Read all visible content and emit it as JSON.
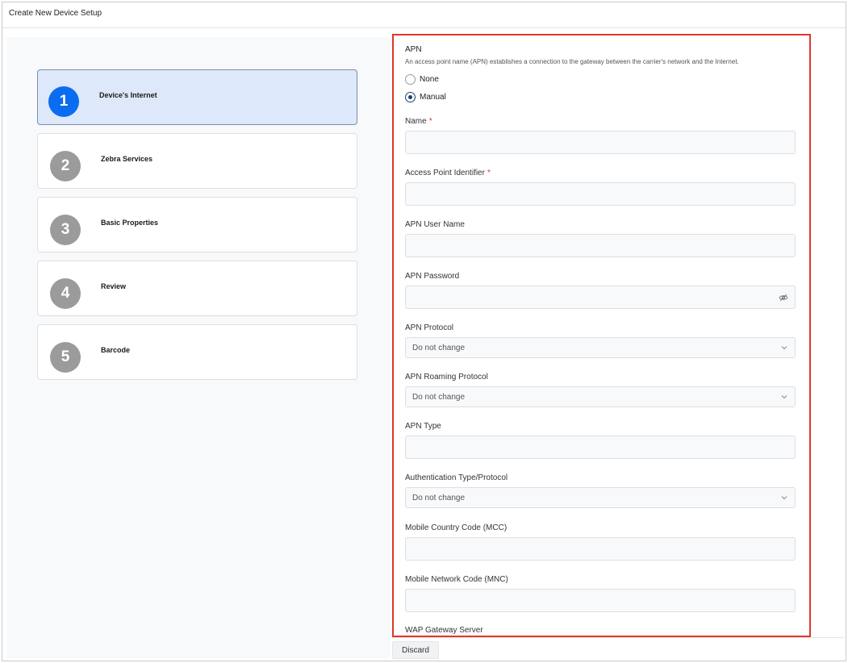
{
  "window": {
    "title": "Create New Device Setup"
  },
  "steps": [
    {
      "number": "1",
      "label": "Device's Internet",
      "active": true
    },
    {
      "number": "2",
      "label": "Zebra Services",
      "active": false
    },
    {
      "number": "3",
      "label": "Basic Properties",
      "active": false
    },
    {
      "number": "4",
      "label": "Review",
      "active": false
    },
    {
      "number": "5",
      "label": "Barcode",
      "active": false
    }
  ],
  "apn": {
    "title": "APN",
    "description": "An access point name (APN) establishes a connection to the gateway between the carrier's network and the Internet.",
    "options": [
      {
        "label": "None",
        "selected": false
      },
      {
        "label": "Manual",
        "selected": true
      }
    ]
  },
  "fields": {
    "name": {
      "label": "Name",
      "required_mark": "*",
      "value": ""
    },
    "access_point_identifier": {
      "label": "Access Point Identifier",
      "required_mark": "*",
      "value": ""
    },
    "apn_user_name": {
      "label": "APN User Name",
      "value": ""
    },
    "apn_password": {
      "label": "APN Password",
      "value": "",
      "icon": "eye-off-icon"
    },
    "apn_protocol": {
      "label": "APN Protocol",
      "value": "Do not change"
    },
    "apn_roaming_protocol": {
      "label": "APN Roaming Protocol",
      "value": "Do not change"
    },
    "apn_type": {
      "label": "APN Type",
      "value": ""
    },
    "authentication_type": {
      "label": "Authentication Type/Protocol",
      "value": "Do not change"
    },
    "mcc": {
      "label": "Mobile Country Code (MCC)",
      "value": ""
    },
    "mnc": {
      "label": "Mobile Network Code (MNC)",
      "value": ""
    },
    "wap_gateway_server": {
      "label": "WAP Gateway Server"
    }
  },
  "footer": {
    "discard_label": "Discard"
  },
  "colors": {
    "accent": "#0a6cf0",
    "active_step_bg": "#dde8fa",
    "highlight_border": "#e0372a",
    "required": "#e0372a"
  }
}
